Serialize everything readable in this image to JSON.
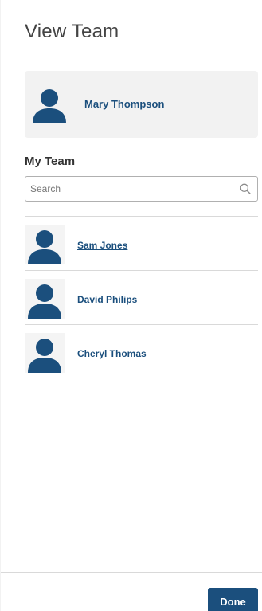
{
  "header": {
    "title": "View Team"
  },
  "current_user": {
    "name": "Mary Thompson",
    "avatar_icon": "person-icon"
  },
  "team": {
    "title": "My Team",
    "search": {
      "placeholder": "Search",
      "value": "",
      "icon": "search-icon"
    },
    "members": [
      {
        "name": "Sam Jones",
        "avatar_icon": "person-icon"
      },
      {
        "name": "David Philips",
        "avatar_icon": "person-icon"
      },
      {
        "name": "Cheryl Thomas",
        "avatar_icon": "person-icon"
      }
    ]
  },
  "footer": {
    "done_label": "Done"
  },
  "colors": {
    "brand": "#1b4f7d",
    "card_bg": "#f2f2f2",
    "divider": "#d9d9d9"
  }
}
